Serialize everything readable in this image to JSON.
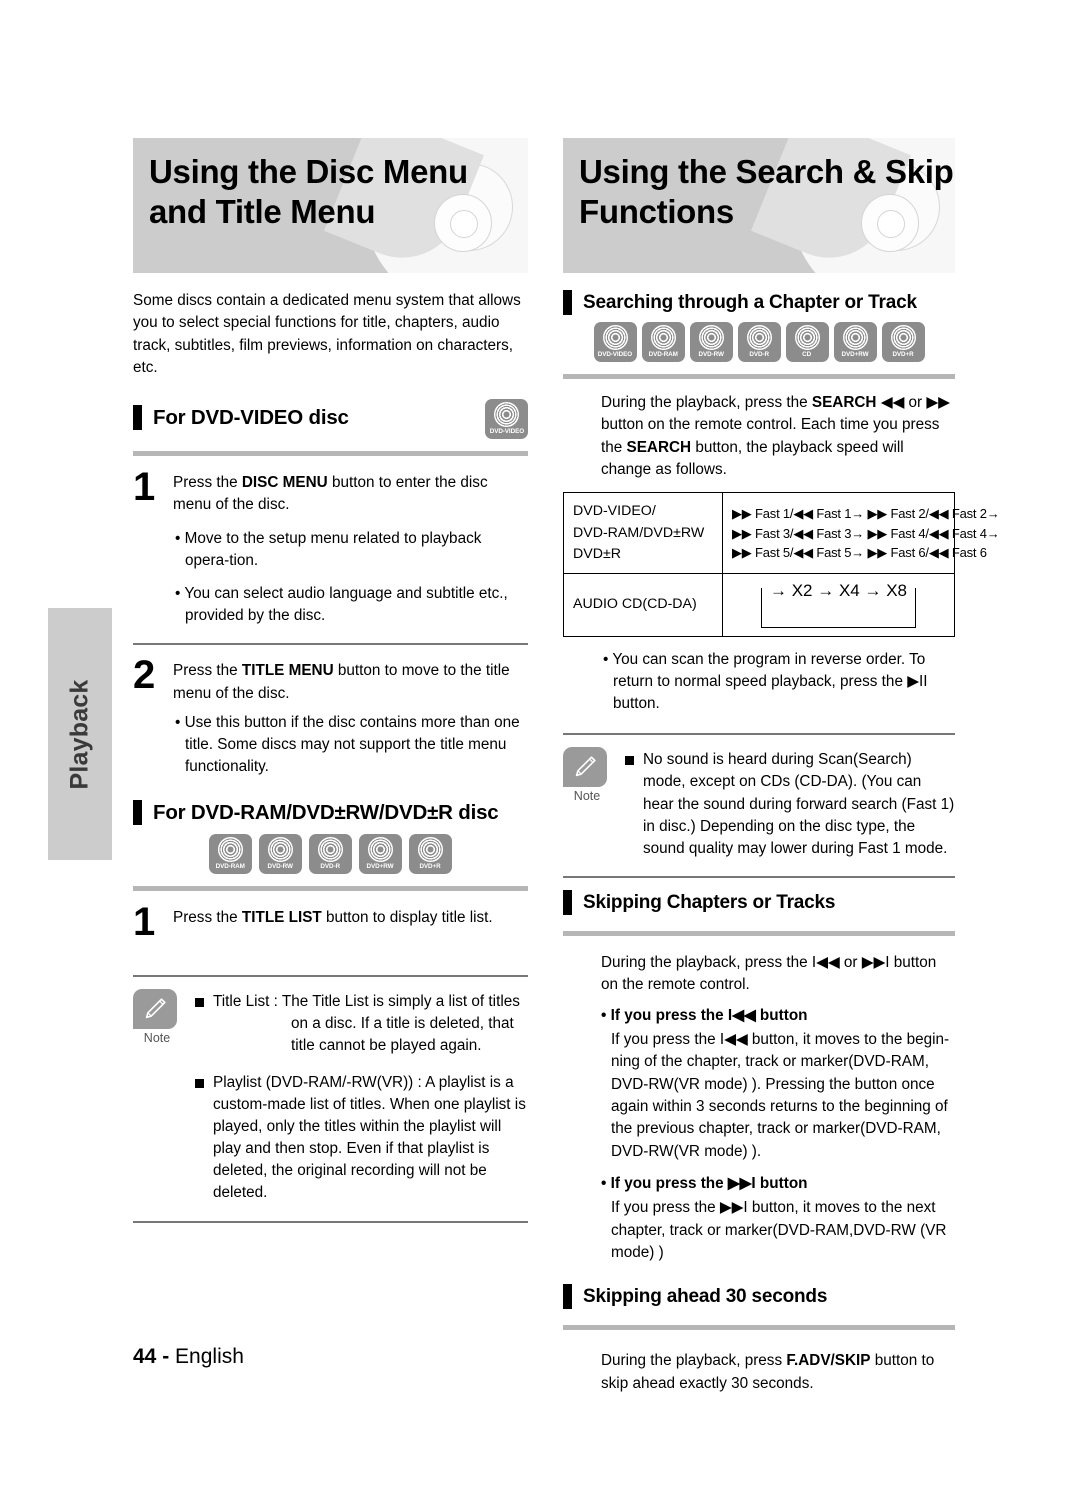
{
  "page": {
    "side_tab_label": "Playback",
    "footer_page_number": "44",
    "footer_separator": "-",
    "footer_language": "English"
  },
  "left_column": {
    "banner": {
      "line1": "Using the Disc Menu",
      "line2": "and Title Menu"
    },
    "intro": "Some discs contain a dedicated menu system that allows you to select special functions for title, chapters, audio track, subtitles, film previews, information on characters, etc.",
    "section_dvd_video": {
      "heading": "For DVD-VIDEO disc",
      "badge": "DVD-VIDEO",
      "steps": [
        {
          "number": "1",
          "text": "Press the DISC MENU button to enter the disc menu of the disc.",
          "text_pre": "Press the ",
          "text_bold": "DISC MENU",
          "text_post": " button to enter the disc menu of the disc.",
          "bullets": [
            "• Move to the setup menu related to playback opera-tion.",
            "• You can select audio language and subtitle etc., provided by the disc."
          ]
        },
        {
          "number": "2",
          "text_pre": "Press the ",
          "text_bold": "TITLE MENU",
          "text_post": " button to move to the title menu of the disc.",
          "bullets": [
            "• Use this button if the disc contains more than one title. Some discs may not support the title menu functionality."
          ]
        }
      ]
    },
    "section_dvd_ram": {
      "heading": "For DVD-RAM/DVD±RW/DVD±R disc",
      "badges": [
        "DVD-RAM",
        "DVD-RW",
        "DVD-R",
        "DVD+RW",
        "DVD+R"
      ],
      "step": {
        "number": "1",
        "text_pre": "Press the ",
        "text_bold": "TITLE LIST",
        "text_post": " button to display title list."
      }
    },
    "note": {
      "label": "Note",
      "items": [
        {
          "lead": "Title List : ",
          "text": "The Title List is simply a list of titles on a disc. If a title is deleted, that title cannot be played again."
        },
        {
          "lead": "",
          "text": "Playlist (DVD-RAM/-RW(VR)) : A playlist is a custom-made list of titles. When one playlist is played, only the titles within the playlist will play and then stop. Even if that playlist is deleted, the original recording will not be deleted."
        }
      ]
    }
  },
  "right_column": {
    "banner": {
      "line1": "Using the Search & Skip",
      "line2": "Functions"
    },
    "section_searching": {
      "heading": "Searching through a Chapter or Track",
      "badges": [
        "DVD-VIDEO",
        "DVD-RAM",
        "DVD-RW",
        "DVD-R",
        "CD",
        "DVD+RW",
        "DVD+R"
      ],
      "body_pre": "During the playback, press the ",
      "body_bold1": "SEARCH",
      "body_mid": " ◀◀ or ▶▶ button on the remote control. Each time you press the ",
      "body_bold2": "SEARCH",
      "body_post": " button, the playback speed will change as follows.",
      "table": {
        "rows": [
          {
            "key_lines": [
              "DVD-VIDEO/",
              "DVD-RAM/DVD±RW",
              "DVD±R"
            ],
            "value_lines": [
              "▶▶ Fast 1/◀◀ Fast 1→ ▶▶ Fast 2/◀◀ Fast 2→",
              "▶▶ Fast 3/◀◀ Fast 3→ ▶▶ Fast 4/◀◀ Fast 4→",
              "▶▶ Fast 5/◀◀ Fast 5→ ▶▶ Fast 6/◀◀ Fast 6"
            ]
          },
          {
            "key_lines": [
              "AUDIO CD(CD-DA)"
            ],
            "loop": "→ X2 → X4 → X8"
          }
        ]
      },
      "after_table_bullet": "• You can scan the program in reverse order. To return to normal speed playback, press the ▶II button.",
      "note": {
        "label": "Note",
        "text": "No sound is heard during Scan(Search) mode, except on CDs (CD-DA). (You can hear the sound during forward search (Fast 1) in disc.) Depending on the disc type, the sound quality may lower during Fast 1 mode."
      }
    },
    "section_skipping": {
      "heading": "Skipping Chapters or Tracks",
      "intro": "During the playback, press the I◀◀ or ▶▶I button on the remote control.",
      "sub1": {
        "heading": "• If you press the I◀◀ button",
        "text": "If you press the I◀◀ button, it moves to the begin-ning of the chapter, track or marker(DVD-RAM, DVD-RW(VR mode) ). Pressing the button once again within 3 seconds returns to the beginning of the previous chapter, track or marker(DVD-RAM, DVD-RW(VR mode) )."
      },
      "sub2": {
        "heading": "• If you press the ▶▶I button",
        "text": "If you press the ▶▶I button, it moves to the next chapter, track or marker(DVD-RAM,DVD-RW (VR mode) )"
      }
    },
    "section_skip30": {
      "heading": "Skipping ahead 30 seconds",
      "body_pre": "During the playback, press ",
      "body_bold": "F.ADV/SKIP",
      "body_post": " button to skip ahead exactly 30 seconds."
    }
  }
}
